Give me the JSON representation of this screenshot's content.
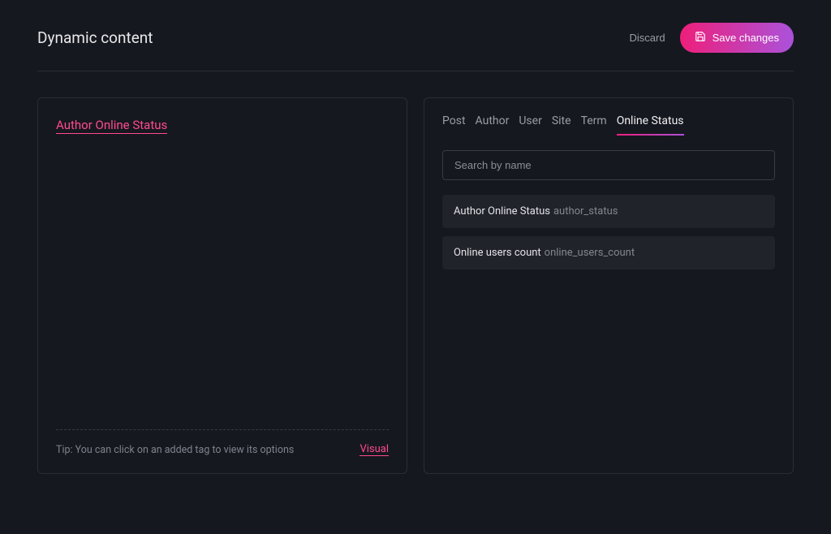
{
  "header": {
    "title": "Dynamic content",
    "discard_label": "Discard",
    "save_label": "Save changes"
  },
  "editor": {
    "tag_label": "Author Online Status",
    "tip_text": "Tip: You can click on an added tag to view its options",
    "visual_label": "Visual"
  },
  "tabs": [
    {
      "label": "Post",
      "active": false
    },
    {
      "label": "Author",
      "active": false
    },
    {
      "label": "User",
      "active": false
    },
    {
      "label": "Site",
      "active": false
    },
    {
      "label": "Term",
      "active": false
    },
    {
      "label": "Online Status",
      "active": true
    }
  ],
  "search": {
    "placeholder": "Search by name"
  },
  "results": [
    {
      "label": "Author Online Status",
      "slug": "author_status"
    },
    {
      "label": "Online users count",
      "slug": "online_users_count"
    }
  ],
  "colors": {
    "accent_start": "#ee1f7a",
    "accent_end": "#ab52db",
    "pink": "#ff4b8d",
    "bg": "#161820"
  }
}
